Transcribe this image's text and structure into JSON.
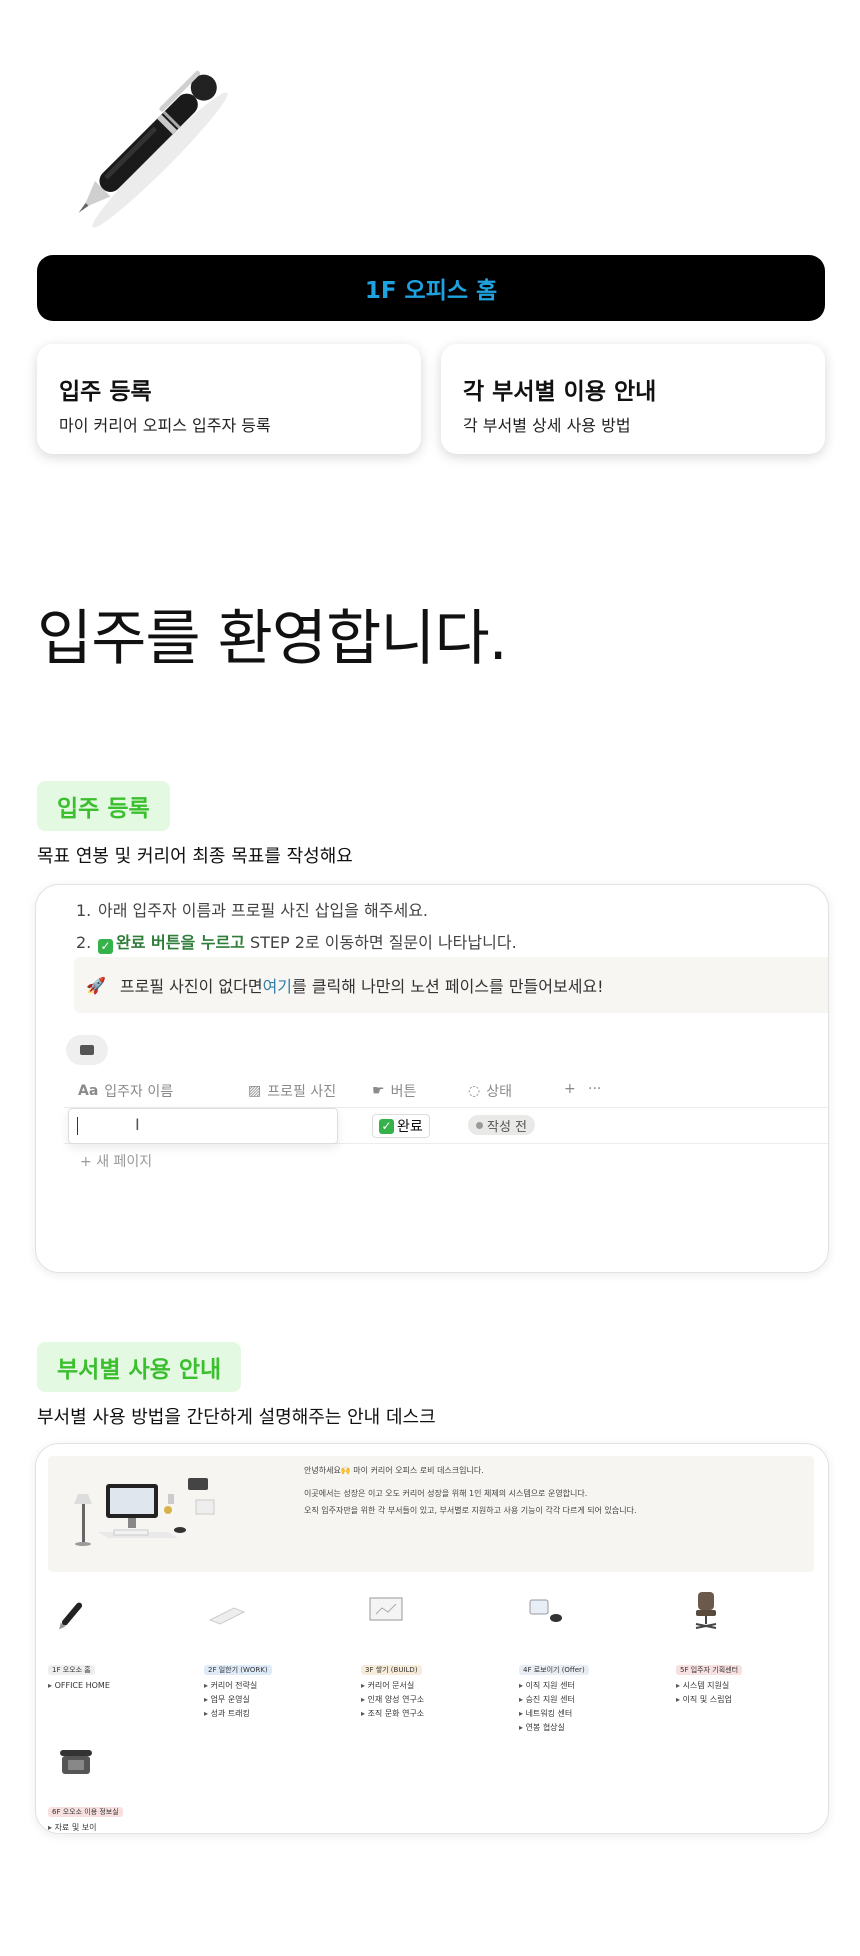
{
  "home_banner": {
    "label": "1F 오피스 홈"
  },
  "nav_cards": [
    {
      "title": "입주 등록",
      "subtitle": "마이 커리어 오피스 입주자 등록"
    },
    {
      "title": "각 부서별 이용 안내",
      "subtitle": "각 부서별 상세 사용 방법"
    }
  ],
  "welcome": "입주를 환영합니다.",
  "registration": {
    "tag": "입주 등록",
    "desc": "목표 연봉 및 커리어 최종 목표를 작성해요",
    "steps": [
      {
        "num": "1.",
        "text": "아래 입주자 이름과 프로필 사진 삽입을 해주세요."
      },
      {
        "num": "2.",
        "highlight": "완료  버튼을 누르고",
        "text": " STEP 2로 이동하면 질문이 나타납니다."
      }
    ],
    "callout": {
      "before": "프로필 사진이 없다면 ",
      "link": "여기",
      "after": "를 클릭해 나만의 노션 페이스를 만들어보세요!"
    },
    "columns": [
      "입주자 이름",
      "프로필 사진",
      "버튼",
      "상태"
    ],
    "row": {
      "button": "완료",
      "status": "작성 전"
    },
    "new_page": "새 페이지"
  },
  "dept_guide": {
    "tag": "부서별 사용 안내",
    "desc": "부서별 사용 방법을 간단하게 설명해주는 안내 데스크",
    "lobby_lines": [
      "안녕하세요🙌 마이 커리어 오피스 로비 데스크입니다.",
      "",
      "이곳에서는 성장은 이고 오도 커리어 성장을 위해 1인 체제의 시스템으로 운영합니다.",
      "오직 입주자만을 위한 각 부서들이 있고, 부서별로 지원하고 사용 기능이 각각 다르게 되어 있습니다."
    ],
    "departments": [
      {
        "badge": "1F 오오소 홈",
        "items": [
          "OFFICE HOME"
        ],
        "color": "#eeeeee"
      },
      {
        "badge": "2F 일한기 (WORK)",
        "items": [
          "커리어 전략실",
          "업무 운영실",
          "성과 트래킹"
        ],
        "color": "#dfeaf7"
      },
      {
        "badge": "3F 쌓기 (BUILD)",
        "items": [
          "커리어 문서실",
          "인재 양성 연구소",
          "조직 문화 연구소"
        ],
        "color": "#f7ecd9"
      },
      {
        "badge": "4F 로보이기 (Offer)",
        "items": [
          "이직 지원 센터",
          "승진 지원 센터",
          "네트워킹 센터",
          "연봉 협상실"
        ],
        "color": "#e9eef5"
      },
      {
        "badge": "5F 입주자 기획센터",
        "items": [
          "시스템 지원실",
          "이직 및 스립업"
        ],
        "color": "#f8e0e0"
      },
      {
        "badge": "6F 오오소 이용 정보실",
        "items": [
          "자료 및 보이"
        ],
        "color": "#f8e0e0"
      }
    ]
  }
}
